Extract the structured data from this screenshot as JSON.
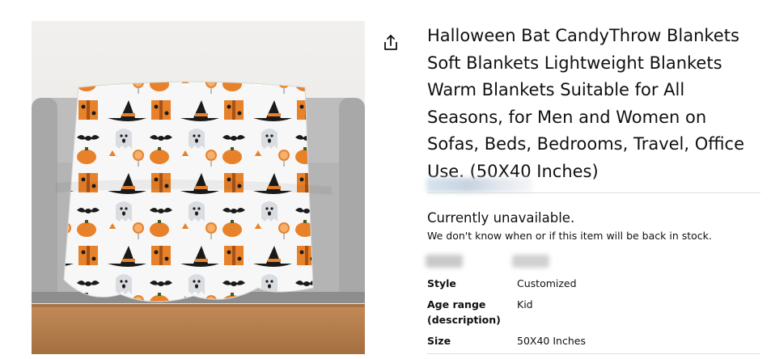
{
  "product": {
    "title": "Halloween Bat CandyThrow Blankets Soft Blankets Lightweight Blankets Warm Blankets Suitable for All Seasons, for Men and Women on Sofas, Beds, Bedrooms, Travel, Office Use. (50X40 Inches)",
    "image_icon": "product-photo",
    "share_icon": "share-icon"
  },
  "availability": {
    "status": "Currently unavailable.",
    "detail": "We don't know when or if this item will be back in stock."
  },
  "specs": {
    "style": {
      "label": "Style",
      "value": "Customized"
    },
    "age_range": {
      "label": "Age range (description)",
      "value": "Kid"
    },
    "size": {
      "label": "Size",
      "value": "50X40 Inches"
    }
  },
  "colors": {
    "text": "#0F1111",
    "divider": "#DDDDDD",
    "pattern_orange": "#E8822A",
    "pattern_black": "#1A1A1A",
    "sofa_gray": "#B9B9B9",
    "floor_wood": "#B27A4A"
  }
}
